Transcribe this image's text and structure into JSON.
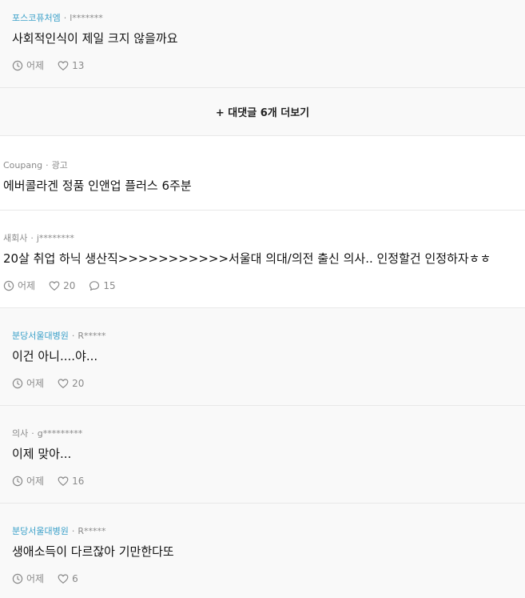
{
  "thread": [
    {
      "kind": "reply",
      "company": "포스코퓨처엠",
      "user": "l*******",
      "text": "사회적인식이 제일 크지 않을까요",
      "time": "어제",
      "likes": "13"
    }
  ],
  "more_replies": {
    "label": "+ 대댓글 6개 더보기"
  },
  "ad": {
    "company": "Coupang",
    "tag": "광고",
    "text": "에버콜라겐 정품 인앤업 플러스 6주분"
  },
  "post": {
    "company": "새회사",
    "user": "j********",
    "text": "20살 취업 하닉 생산직>>>>>>>>>>>서울대 의대/의전 출신 의사.. 인정할건 인정하자ㅎㅎ",
    "time": "어제",
    "likes": "20",
    "comments": "15"
  },
  "replies": [
    {
      "company": "분당서울대병원",
      "user": "R*****",
      "text": "이건 아니....야...",
      "time": "어제",
      "likes": "20"
    },
    {
      "company": "의사",
      "user": "g*********",
      "text": "이제 맞아...",
      "time": "어제",
      "likes": "16"
    },
    {
      "company": "분당서울대병원",
      "user": "R*****",
      "text": "생애소득이 다르잖아 기만한다또",
      "time": "어제",
      "likes": "6"
    }
  ],
  "icons": {
    "time": "clock-icon",
    "like": "heart-icon",
    "comment": "speech-bubble-icon"
  },
  "colors": {
    "company_accent": "#3aa0c9",
    "meta": "#8a8a8a",
    "text": "#111111",
    "reply_bg": "#f9f9f9"
  }
}
